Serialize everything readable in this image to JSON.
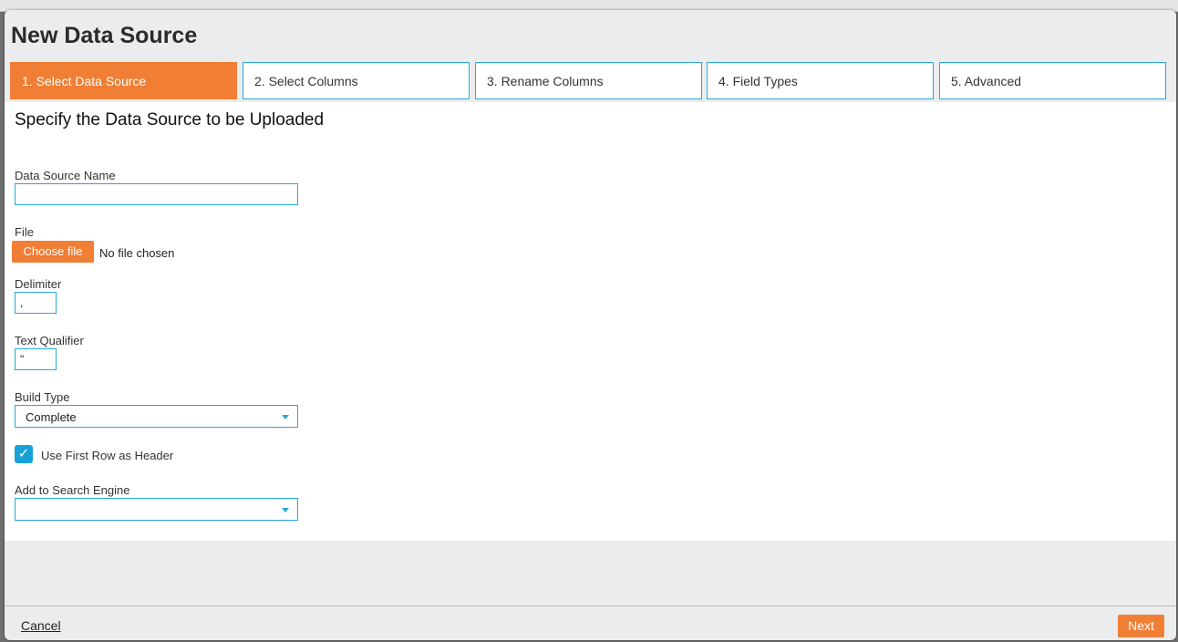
{
  "dialog": {
    "title": "New Data Source"
  },
  "steps": [
    {
      "label": "1. Select Data Source",
      "active": true
    },
    {
      "label": "2. Select Columns",
      "active": false
    },
    {
      "label": "3. Rename Columns",
      "active": false
    },
    {
      "label": "4. Field Types",
      "active": false
    },
    {
      "label": "5. Advanced",
      "active": false
    }
  ],
  "form": {
    "section_title": "Specify the Data Source to be Uploaded",
    "data_source_name": {
      "label": "Data Source Name",
      "value": ""
    },
    "file": {
      "label": "File",
      "button_label": "Choose file",
      "status": "No file chosen"
    },
    "delimiter": {
      "label": "Delimiter",
      "value": ","
    },
    "text_qualifier": {
      "label": "Text Qualifier",
      "value": "\""
    },
    "build_type": {
      "label": "Build Type",
      "value": "Complete"
    },
    "use_first_row_header": {
      "label": "Use First Row as Header",
      "checked": true
    },
    "search_engine": {
      "label": "Add to Search Engine",
      "value": ""
    }
  },
  "footer": {
    "cancel_label": "Cancel",
    "next_label": "Next"
  },
  "colors": {
    "accent": "#f07e35",
    "border": "#2aa7d8",
    "checkbox": "#17a1d7"
  }
}
